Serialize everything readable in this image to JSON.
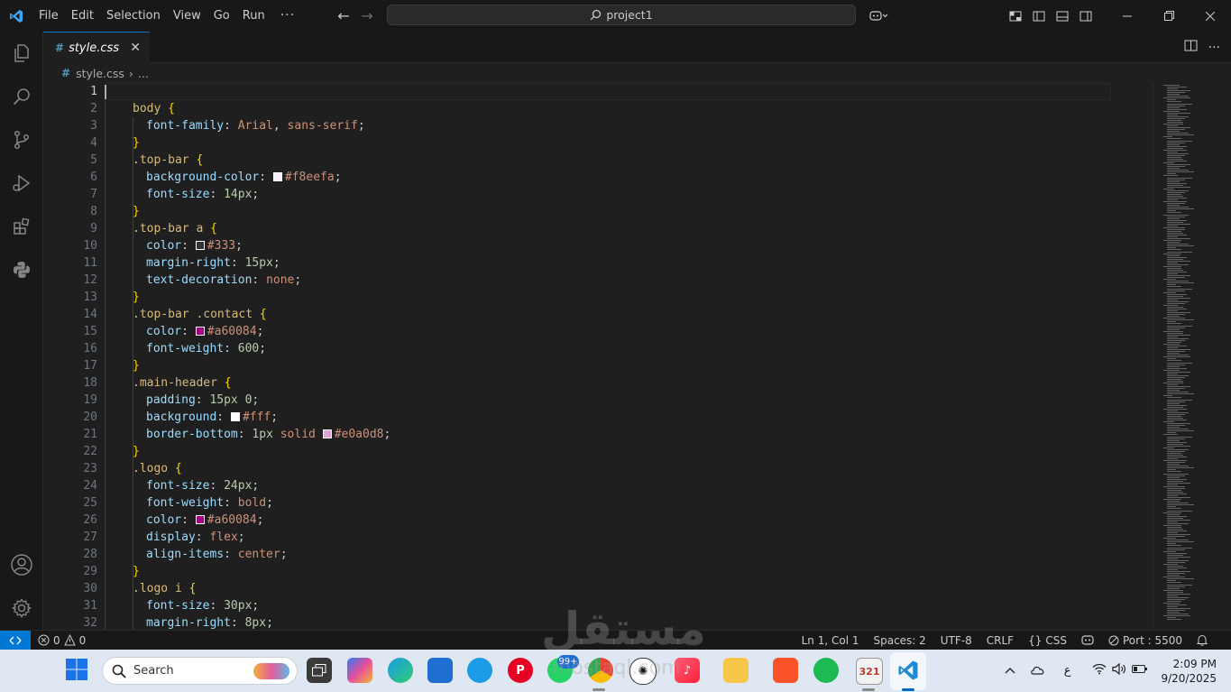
{
  "app": {
    "menu": [
      "File",
      "Edit",
      "Selection",
      "View",
      "Go",
      "Run"
    ],
    "menu_more": "···",
    "search_text": "project1"
  },
  "tab": {
    "name": "style.css",
    "icon": "#",
    "close": "✕"
  },
  "breadcrumb": {
    "file": "style.css",
    "sep": "›",
    "more": "..."
  },
  "editor": {
    "active_line": 1,
    "lines": [
      {
        "n": "1",
        "t": []
      },
      {
        "n": "2",
        "t": [
          [
            "sel",
            "body "
          ],
          [
            "brace",
            "{"
          ]
        ]
      },
      {
        "n": "3",
        "t": [
          [
            "prop",
            "font-family"
          ],
          [
            "punc",
            ": "
          ],
          [
            "val",
            "Arial"
          ],
          [
            "punc",
            ", "
          ],
          [
            "val",
            "sans-serif"
          ],
          [
            "punc",
            ";"
          ]
        ]
      },
      {
        "n": "4",
        "t": [
          [
            "brace",
            "}"
          ]
        ]
      },
      {
        "n": "5",
        "t": [
          [
            "sel",
            ".top-bar "
          ],
          [
            "brace",
            "{"
          ]
        ]
      },
      {
        "n": "6",
        "t": [
          [
            "prop",
            "background-color"
          ],
          [
            "punc",
            ": "
          ],
          [
            "swatch",
            "#f8eefa"
          ],
          [
            "val",
            "#f8eefa"
          ],
          [
            "punc",
            ";"
          ]
        ]
      },
      {
        "n": "7",
        "t": [
          [
            "prop",
            "font-size"
          ],
          [
            "punc",
            ": "
          ],
          [
            "num",
            "14px"
          ],
          [
            "punc",
            ";"
          ]
        ]
      },
      {
        "n": "8",
        "t": [
          [
            "brace",
            "}"
          ]
        ]
      },
      {
        "n": "9",
        "t": [
          [
            "sel",
            ".top-bar a "
          ],
          [
            "brace",
            "{"
          ]
        ]
      },
      {
        "n": "10",
        "t": [
          [
            "prop",
            "color"
          ],
          [
            "punc",
            ": "
          ],
          [
            "swatch",
            "#333"
          ],
          [
            "val",
            "#333"
          ],
          [
            "punc",
            ";"
          ]
        ]
      },
      {
        "n": "11",
        "t": [
          [
            "prop",
            "margin-right"
          ],
          [
            "punc",
            ": "
          ],
          [
            "num",
            "15px"
          ],
          [
            "punc",
            ";"
          ]
        ]
      },
      {
        "n": "12",
        "t": [
          [
            "prop",
            "text-decoration"
          ],
          [
            "punc",
            ": "
          ],
          [
            "val",
            "none"
          ],
          [
            "punc",
            ";"
          ]
        ]
      },
      {
        "n": "13",
        "t": [
          [
            "brace",
            "}"
          ]
        ]
      },
      {
        "n": "14",
        "t": [
          [
            "sel",
            ".top-bar .contact "
          ],
          [
            "brace",
            "{"
          ]
        ]
      },
      {
        "n": "15",
        "t": [
          [
            "prop",
            "color"
          ],
          [
            "punc",
            ": "
          ],
          [
            "swatch",
            "#a60084"
          ],
          [
            "val",
            "#a60084"
          ],
          [
            "punc",
            ";"
          ]
        ]
      },
      {
        "n": "16",
        "t": [
          [
            "prop",
            "font-weight"
          ],
          [
            "punc",
            ": "
          ],
          [
            "num",
            "600"
          ],
          [
            "punc",
            ";"
          ]
        ]
      },
      {
        "n": "17",
        "t": [
          [
            "brace",
            "}"
          ]
        ]
      },
      {
        "n": "18",
        "t": [
          [
            "sel",
            ".main-header "
          ],
          [
            "brace",
            "{"
          ]
        ]
      },
      {
        "n": "19",
        "t": [
          [
            "prop",
            "padding"
          ],
          [
            "punc",
            ": "
          ],
          [
            "num",
            "15px 0"
          ],
          [
            "punc",
            ";"
          ]
        ]
      },
      {
        "n": "20",
        "t": [
          [
            "prop",
            "background"
          ],
          [
            "punc",
            ": "
          ],
          [
            "swatch",
            "#fff"
          ],
          [
            "val",
            "#fff"
          ],
          [
            "punc",
            ";"
          ]
        ]
      },
      {
        "n": "21",
        "t": [
          [
            "prop",
            "border-bottom"
          ],
          [
            "punc",
            ": "
          ],
          [
            "num",
            "1px "
          ],
          [
            "val",
            "solid "
          ],
          [
            "swatch",
            "#e0a0d8"
          ],
          [
            "val",
            "#e0a0d8"
          ],
          [
            "punc",
            ";"
          ]
        ]
      },
      {
        "n": "22",
        "t": [
          [
            "brace",
            "}"
          ]
        ]
      },
      {
        "n": "23",
        "t": [
          [
            "sel",
            ".logo "
          ],
          [
            "brace",
            "{"
          ]
        ]
      },
      {
        "n": "24",
        "t": [
          [
            "prop",
            "font-size"
          ],
          [
            "punc",
            ": "
          ],
          [
            "num",
            "24px"
          ],
          [
            "punc",
            ";"
          ]
        ]
      },
      {
        "n": "25",
        "t": [
          [
            "prop",
            "font-weight"
          ],
          [
            "punc",
            ": "
          ],
          [
            "val",
            "bold"
          ],
          [
            "punc",
            ";"
          ]
        ]
      },
      {
        "n": "26",
        "t": [
          [
            "prop",
            "color"
          ],
          [
            "punc",
            ": "
          ],
          [
            "swatch",
            "#a60084"
          ],
          [
            "val",
            "#a60084"
          ],
          [
            "punc",
            ";"
          ]
        ]
      },
      {
        "n": "27",
        "t": [
          [
            "prop",
            "display"
          ],
          [
            "punc",
            ": "
          ],
          [
            "val",
            "flex"
          ],
          [
            "punc",
            ";"
          ]
        ]
      },
      {
        "n": "28",
        "t": [
          [
            "prop",
            "align-items"
          ],
          [
            "punc",
            ": "
          ],
          [
            "val",
            "center"
          ],
          [
            "punc",
            ";"
          ]
        ]
      },
      {
        "n": "29",
        "t": [
          [
            "brace",
            "}"
          ]
        ]
      },
      {
        "n": "30",
        "t": [
          [
            "sel",
            ".logo i "
          ],
          [
            "brace",
            "{"
          ]
        ]
      },
      {
        "n": "31",
        "t": [
          [
            "prop",
            "font-size"
          ],
          [
            "punc",
            ": "
          ],
          [
            "num",
            "30px"
          ],
          [
            "punc",
            ";"
          ]
        ]
      },
      {
        "n": "32",
        "t": [
          [
            "prop",
            "margin-right"
          ],
          [
            "punc",
            ": "
          ],
          [
            "num",
            "8px"
          ],
          [
            "punc",
            ";"
          ]
        ]
      }
    ]
  },
  "status": {
    "errors": "0",
    "warnings": "0",
    "position": "Ln 1, Col 1",
    "spaces": "Spaces: 2",
    "encoding": "UTF-8",
    "eol": "CRLF",
    "language": "CSS",
    "port": "Port : 5500"
  },
  "taskbar": {
    "search": "Search",
    "badge": "99+",
    "lang": "ع",
    "time": "2:09 PM",
    "date": "9/20/2025"
  },
  "watermark": {
    "text": "مستقل",
    "url": "mostaql.com"
  },
  "colors": {
    "accent": "#0078d4",
    "selector": "#d7ba7d",
    "property": "#9cdcfe",
    "value": "#ce9178",
    "number": "#b5cea8"
  }
}
